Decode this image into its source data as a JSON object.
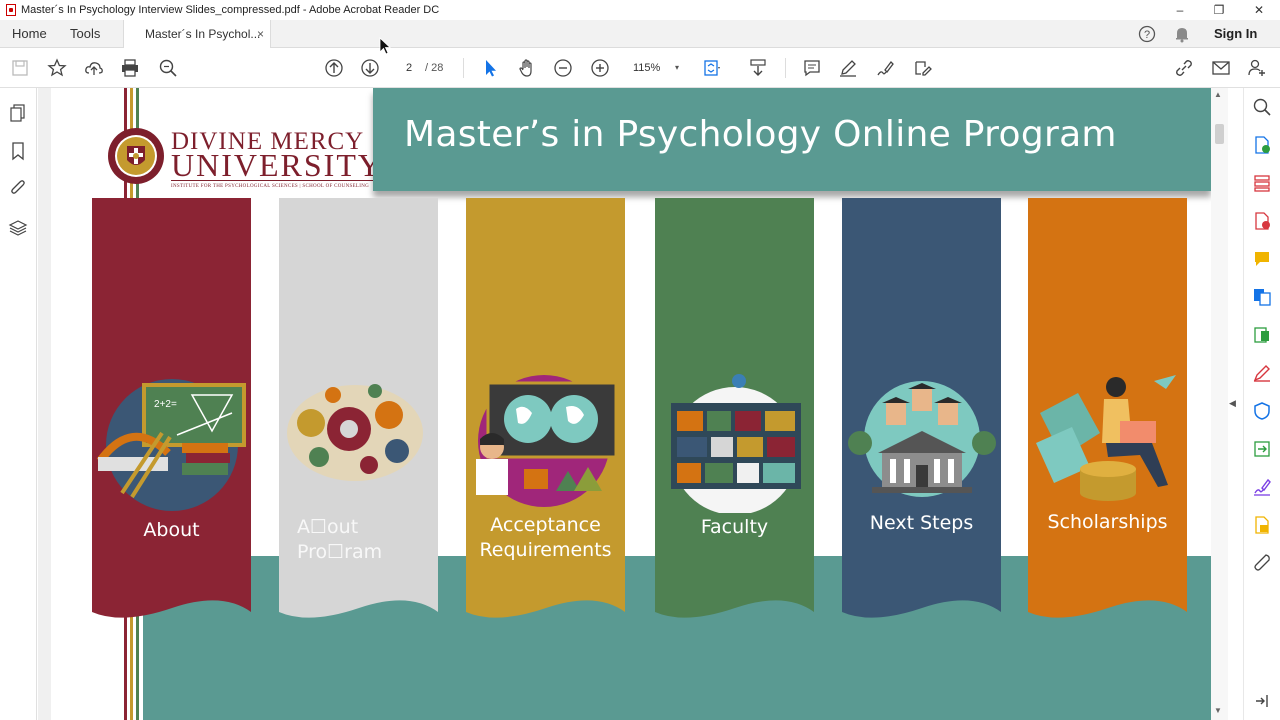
{
  "window": {
    "title": "Master´s In Psychology Interview Slides_compressed.pdf - Adobe Acrobat Reader DC",
    "controls": {
      "minimize": "–",
      "restore": "❐",
      "close": "✕"
    }
  },
  "tabs": {
    "home": "Home",
    "tools": "Tools",
    "document": "Master´s In Psychol...",
    "close": "×",
    "sign_in": "Sign In"
  },
  "toolbar": {
    "current_page": "2",
    "page_total": "/ 28",
    "zoom": "115%",
    "zoom_caret": "▾"
  },
  "slide": {
    "title": "Master’s in Psychology Online Program",
    "logo": {
      "line1": "DIVINE MERCY",
      "line2": "UNIVERSITY",
      "subline": "INSTITUTE FOR THE PSYCHOLOGICAL SCIENCES | SCHOOL OF COUNSELING"
    },
    "banners": [
      {
        "label": "About",
        "color": "#8b2434",
        "icon": "classroom-board-icon"
      },
      {
        "label": "A☐out Pro☐ram",
        "color": "#d6d6d6",
        "icon": "gear-brain-icon"
      },
      {
        "label": "Acceptance Requirements",
        "color": "#c49a2e",
        "icon": "world-map-teacher-icon"
      },
      {
        "label": "Faculty",
        "color": "#4f8152",
        "icon": "bookshelf-icon"
      },
      {
        "label": "Next Steps",
        "color": "#3b5775",
        "icon": "graduates-building-icon"
      },
      {
        "label": "Scholarships",
        "color": "#d47312",
        "icon": "money-laptop-person-icon"
      }
    ],
    "colors": {
      "teal": "#5a9a92",
      "maroon": "#7d1f2c",
      "stripe_red": "#8b2434",
      "stripe_gold": "#c49a2e",
      "stripe_green": "#4f8152"
    }
  }
}
